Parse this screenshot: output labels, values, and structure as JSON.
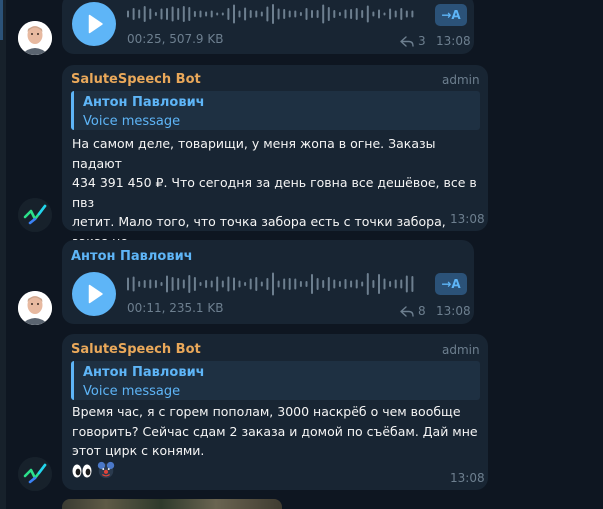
{
  "colors": {
    "background": "#0e1621",
    "bubble": "#182533",
    "accent": "#5eb5f7",
    "bot_name": "#e9a85a",
    "muted": "#6d7f8f"
  },
  "messages": [
    {
      "type": "voice",
      "duration_size": "00:25, 507.9 KB",
      "replies": "3",
      "time": "13:08",
      "transcribe_label": "→A"
    },
    {
      "type": "bot_reply",
      "sender": "SaluteSpeech Bot",
      "role": "admin",
      "quote_author": "Антон Павлович",
      "quote_text": "Voice message",
      "text": "На самом деле, товарищи, у меня жопа в огне. Заказы падают\n434 391 450 ₽. Что сегодня за день говна все дешёвое, все в пвз\nлетит. Мало того, что точка забора есть с точки забора, заказ не\nпадает, падает с точки отдачи и все дальше и дальше не в\nМоскву, а в область.",
      "time": "13:08"
    },
    {
      "type": "voice",
      "sender": "Антон Павлович",
      "duration_size": "00:11, 235.1 KB",
      "replies": "8",
      "time": "13:08",
      "transcribe_label": "→A"
    },
    {
      "type": "bot_reply",
      "sender": "SaluteSpeech Bot",
      "role": "admin",
      "quote_author": "Антон Павлович",
      "quote_text": "Voice message",
      "text": "Время час, я с горем пополам, 3000 наскрёб о чем вообще\nговорить? Сейчас сдам 2 заказа и домой по съёбам. Дай мне\nэтот цирк с конями.",
      "reactions": [
        "eyes-emoji",
        "clown-emoji"
      ],
      "time": "13:08"
    }
  ]
}
